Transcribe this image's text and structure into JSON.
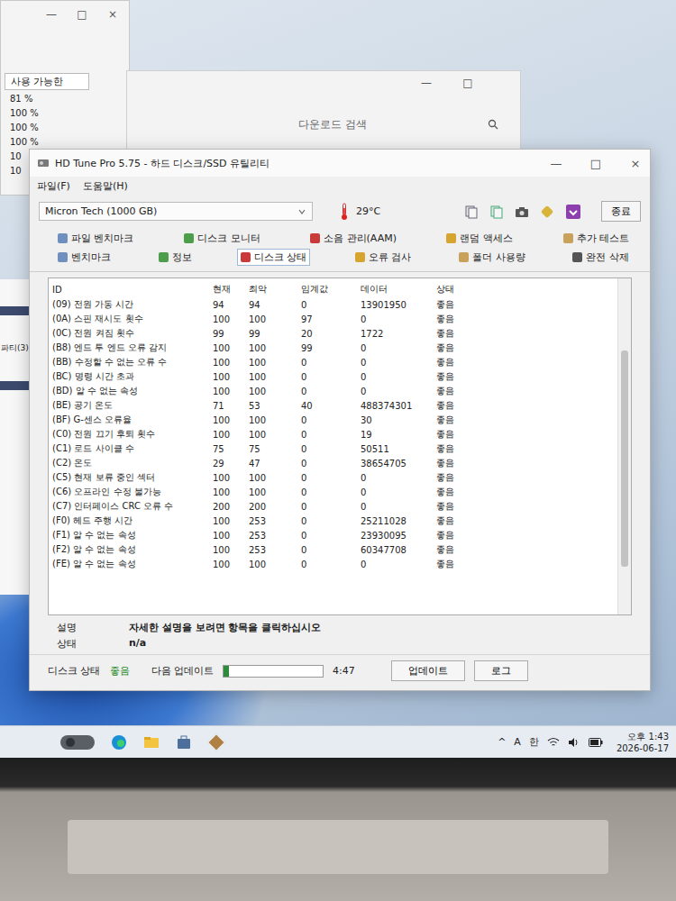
{
  "background_window": {
    "controls": [
      "—",
      "□",
      "×"
    ],
    "column": "사용 가능한",
    "values": [
      "81 %",
      "100 %",
      "100 %",
      "100 %",
      "10",
      "10"
    ]
  },
  "side_window": {
    "label": "파티(3)"
  },
  "search_window": {
    "controls": [
      "—",
      "□"
    ],
    "search": {
      "placeholder": "다운로드 검색"
    }
  },
  "main_window": {
    "title": "HD Tune Pro 5.75 - 하드 디스크/SSD 유틸리티",
    "controls": [
      "—",
      "□",
      "×"
    ],
    "menu": [
      "파일(F)",
      "도움말(H)"
    ],
    "drive": "Micron Tech (1000 GB)",
    "temperature": "29°C",
    "exit_button": "종료",
    "tabs_row1": [
      {
        "label": "파일 벤치마크",
        "selected": false
      },
      {
        "label": "디스크 모니터",
        "selected": false
      },
      {
        "label": "소음 관리(AAM)",
        "selected": false
      },
      {
        "label": "랜덤 액세스",
        "selected": false
      },
      {
        "label": "추가 테스트",
        "selected": false
      }
    ],
    "tabs_row2": [
      {
        "label": "벤치마크",
        "selected": false
      },
      {
        "label": "정보",
        "selected": false
      },
      {
        "label": "디스크 상태",
        "selected": true
      },
      {
        "label": "오류 검사",
        "selected": false
      },
      {
        "label": "폴더 사용량",
        "selected": false
      },
      {
        "label": "완전 삭제",
        "selected": false
      }
    ],
    "table": {
      "columns": [
        "ID",
        "현재",
        "최악",
        "임계값",
        "데이터",
        "상태"
      ],
      "rows": [
        {
          "id": "(09) 전원 가동 시간",
          "current": "94",
          "worst": "94",
          "threshold": "0",
          "data": "13901950",
          "status": "좋음"
        },
        {
          "id": "(0A) 스핀 재시도 횟수",
          "current": "100",
          "worst": "100",
          "threshold": "97",
          "data": "0",
          "status": "좋음"
        },
        {
          "id": "(0C) 전원 켜짐 횟수",
          "current": "99",
          "worst": "99",
          "threshold": "20",
          "data": "1722",
          "status": "좋음"
        },
        {
          "id": "(B8) 엔드 투 엔드 오류 감지",
          "current": "100",
          "worst": "100",
          "threshold": "99",
          "data": "0",
          "status": "좋음"
        },
        {
          "id": "(BB) 수정할 수 없는 오류 수",
          "current": "100",
          "worst": "100",
          "threshold": "0",
          "data": "0",
          "status": "좋음"
        },
        {
          "id": "(BC) 명령 시간 초과",
          "current": "100",
          "worst": "100",
          "threshold": "0",
          "data": "0",
          "status": "좋음"
        },
        {
          "id": "(BD) 알 수 없는 속성",
          "current": "100",
          "worst": "100",
          "threshold": "0",
          "data": "0",
          "status": "좋음"
        },
        {
          "id": "(BE) 공기 온도",
          "current": "71",
          "worst": "53",
          "threshold": "40",
          "data": "488374301",
          "status": "좋음"
        },
        {
          "id": "(BF) G-센스 오류율",
          "current": "100",
          "worst": "100",
          "threshold": "0",
          "data": "30",
          "status": "좋음"
        },
        {
          "id": "(C0) 전원 끄기 후퇴 횟수",
          "current": "100",
          "worst": "100",
          "threshold": "0",
          "data": "19",
          "status": "좋음"
        },
        {
          "id": "(C1) 로드 사이클 수",
          "current": "75",
          "worst": "75",
          "threshold": "0",
          "data": "50511",
          "status": "좋음"
        },
        {
          "id": "(C2) 온도",
          "current": "29",
          "worst": "47",
          "threshold": "0",
          "data": "38654705",
          "status": "좋음"
        },
        {
          "id": "(C5) 현재 보류 중인 섹터",
          "current": "100",
          "worst": "100",
          "threshold": "0",
          "data": "0",
          "status": "좋음"
        },
        {
          "id": "(C6) 오프라인 수정 불가능",
          "current": "100",
          "worst": "100",
          "threshold": "0",
          "data": "0",
          "status": "좋음"
        },
        {
          "id": "(C7) 인터페이스 CRC 오류 수",
          "current": "200",
          "worst": "200",
          "threshold": "0",
          "data": "0",
          "status": "좋음"
        },
        {
          "id": "(F0) 헤드 주행 시간",
          "current": "100",
          "worst": "253",
          "threshold": "0",
          "data": "25211028",
          "status": "좋음"
        },
        {
          "id": "(F1) 알 수 없는 속성",
          "current": "100",
          "worst": "253",
          "threshold": "0",
          "data": "23930095",
          "status": "좋음"
        },
        {
          "id": "(F2) 알 수 없는 속성",
          "current": "100",
          "worst": "253",
          "threshold": "0",
          "data": "60347708",
          "status": "좋음"
        },
        {
          "id": "(FE) 알 수 없는 속성",
          "current": "100",
          "worst": "100",
          "threshold": "0",
          "data": "0",
          "status": "좋음"
        }
      ]
    },
    "description": {
      "label": "설명",
      "text": "자세한 설명을 보려면 항목을 클릭하십시오"
    },
    "health": {
      "label": "상태",
      "value": "n/a"
    },
    "status_bar": {
      "label": "디스크 상태",
      "value": "좋음",
      "next_update_label": "다음 업데이트",
      "level": 0.05,
      "time": "4:47",
      "buttons": [
        "업데이트",
        "로그"
      ]
    }
  },
  "taskbar": {
    "tray": [
      "^",
      "A",
      "한"
    ],
    "time": "오후 1:43",
    "date": "2026-06-17"
  }
}
